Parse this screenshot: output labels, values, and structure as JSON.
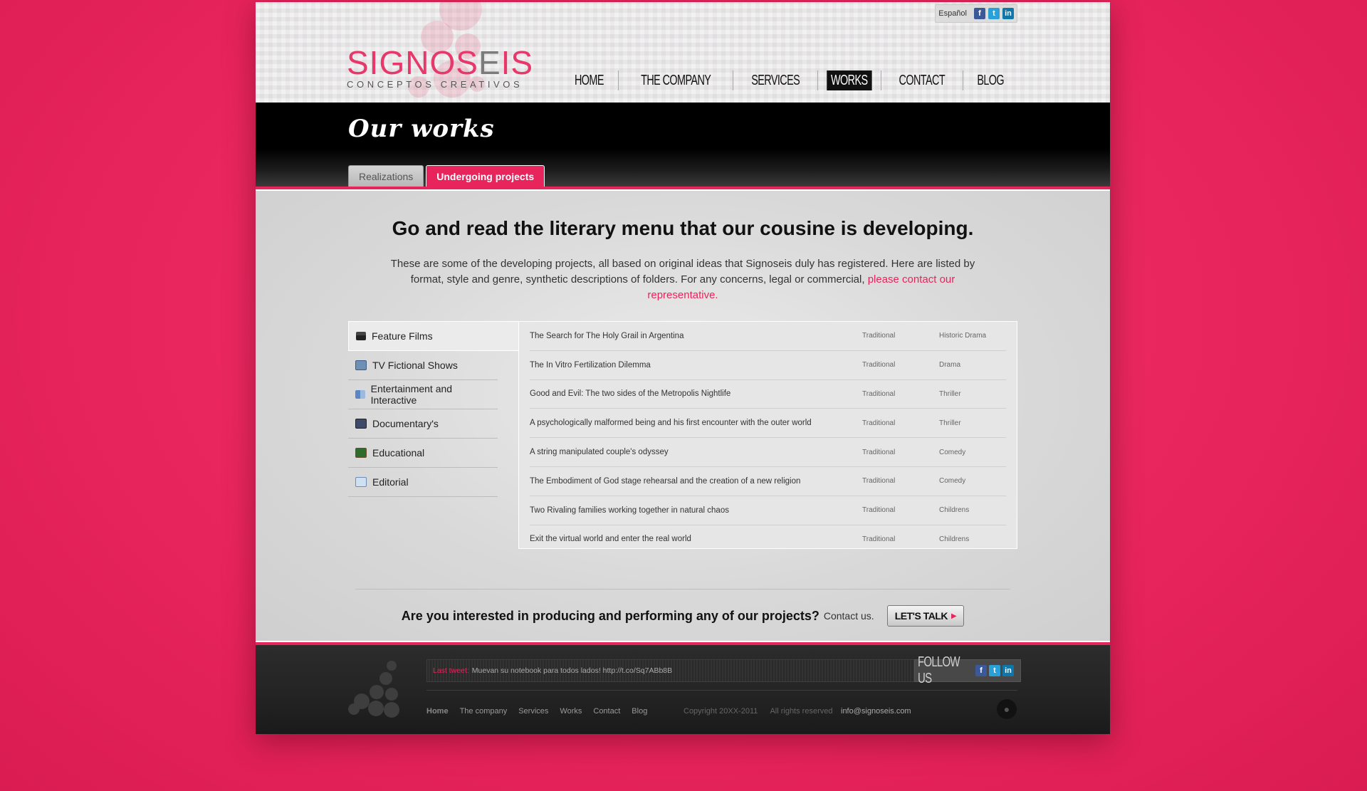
{
  "header": {
    "logo_main_pink": "SIGNOS",
    "logo_main_grey": "E",
    "logo_main_pink2": "IS",
    "logo_sub": "CONCEPTOS CREATIVOS",
    "language": "Español",
    "social_icons": [
      "facebook-icon",
      "twitter-icon",
      "linkedin-icon"
    ],
    "nav": [
      "HOME",
      "THE COMPANY",
      "SERVICES",
      "WORKS",
      "CONTACT",
      "BLOG"
    ],
    "nav_active": "WORKS"
  },
  "band": {
    "title": "Our works",
    "tabs": [
      "Realizations",
      "Undergoing projects"
    ],
    "active_tab": "Undergoing projects"
  },
  "main": {
    "headline": "Go and read the literary menu that our cousine is developing.",
    "intro_text": "These are some of the developing projects, all based on original ideas that Signoseis duly has registered. Here are listed by format, style and genre, synthetic descriptions of folders. For any concerns, legal or commercial,",
    "intro_link": "please contact our representative.",
    "categories": [
      {
        "label": "Feature Films",
        "icon": "clapperboard-icon"
      },
      {
        "label": "TV Fictional Shows",
        "icon": "tv-icon"
      },
      {
        "label": "Entertainment and Interactive",
        "icon": "interactive-icon"
      },
      {
        "label": "Documentary's",
        "icon": "documentary-icon"
      },
      {
        "label": "Educational",
        "icon": "chalkboard-icon"
      },
      {
        "label": "Editorial",
        "icon": "book-icon"
      }
    ],
    "selected_category": "Feature Films",
    "projects": [
      {
        "title": "The Search for The Holy Grail in Argentina",
        "format": "Traditional",
        "genre": "Historic Drama"
      },
      {
        "title": "The In Vitro Fertilization Dilemma",
        "format": "Traditional",
        "genre": "Drama"
      },
      {
        "title": "Good and Evil: The two sides of the Metropolis Nightlife",
        "format": "Traditional",
        "genre": "Thriller"
      },
      {
        "title": "A psychologically malformed being and his first encounter with the outer world",
        "format": "Traditional",
        "genre": "Thriller"
      },
      {
        "title": "A string manipulated couple's odyssey",
        "format": "Traditional",
        "genre": "Comedy"
      },
      {
        "title": "The Embodiment of God stage rehearsal and the creation of a new religion",
        "format": "Traditional",
        "genre": "Comedy"
      },
      {
        "title": "Two Rivaling families working together in natural chaos",
        "format": "Traditional",
        "genre": "Childrens"
      },
      {
        "title": "Exit the virtual world and enter the real world",
        "format": "Traditional",
        "genre": "Childrens"
      }
    ],
    "cta_question": "Are you interested in producing and performing any of our projects?",
    "cta_contact": "Contact us.",
    "cta_button": "LET'S TALK"
  },
  "footer": {
    "last_tweet_label": "Last tweet:",
    "last_tweet_text": "Muevan su notebook para todos lados! http://t.co/Sq7ABb8B",
    "follow_us": "FOLLOW US",
    "nav": [
      "Home",
      "The company",
      "Services",
      "Works",
      "Contact",
      "Blog"
    ],
    "copyright": "Copyright 20XX-2011",
    "rights": "All rights reserved",
    "email": "info@signoseis.com"
  },
  "colors": {
    "accent": "#e8245c",
    "band": "#000000",
    "footer": "#262626"
  }
}
